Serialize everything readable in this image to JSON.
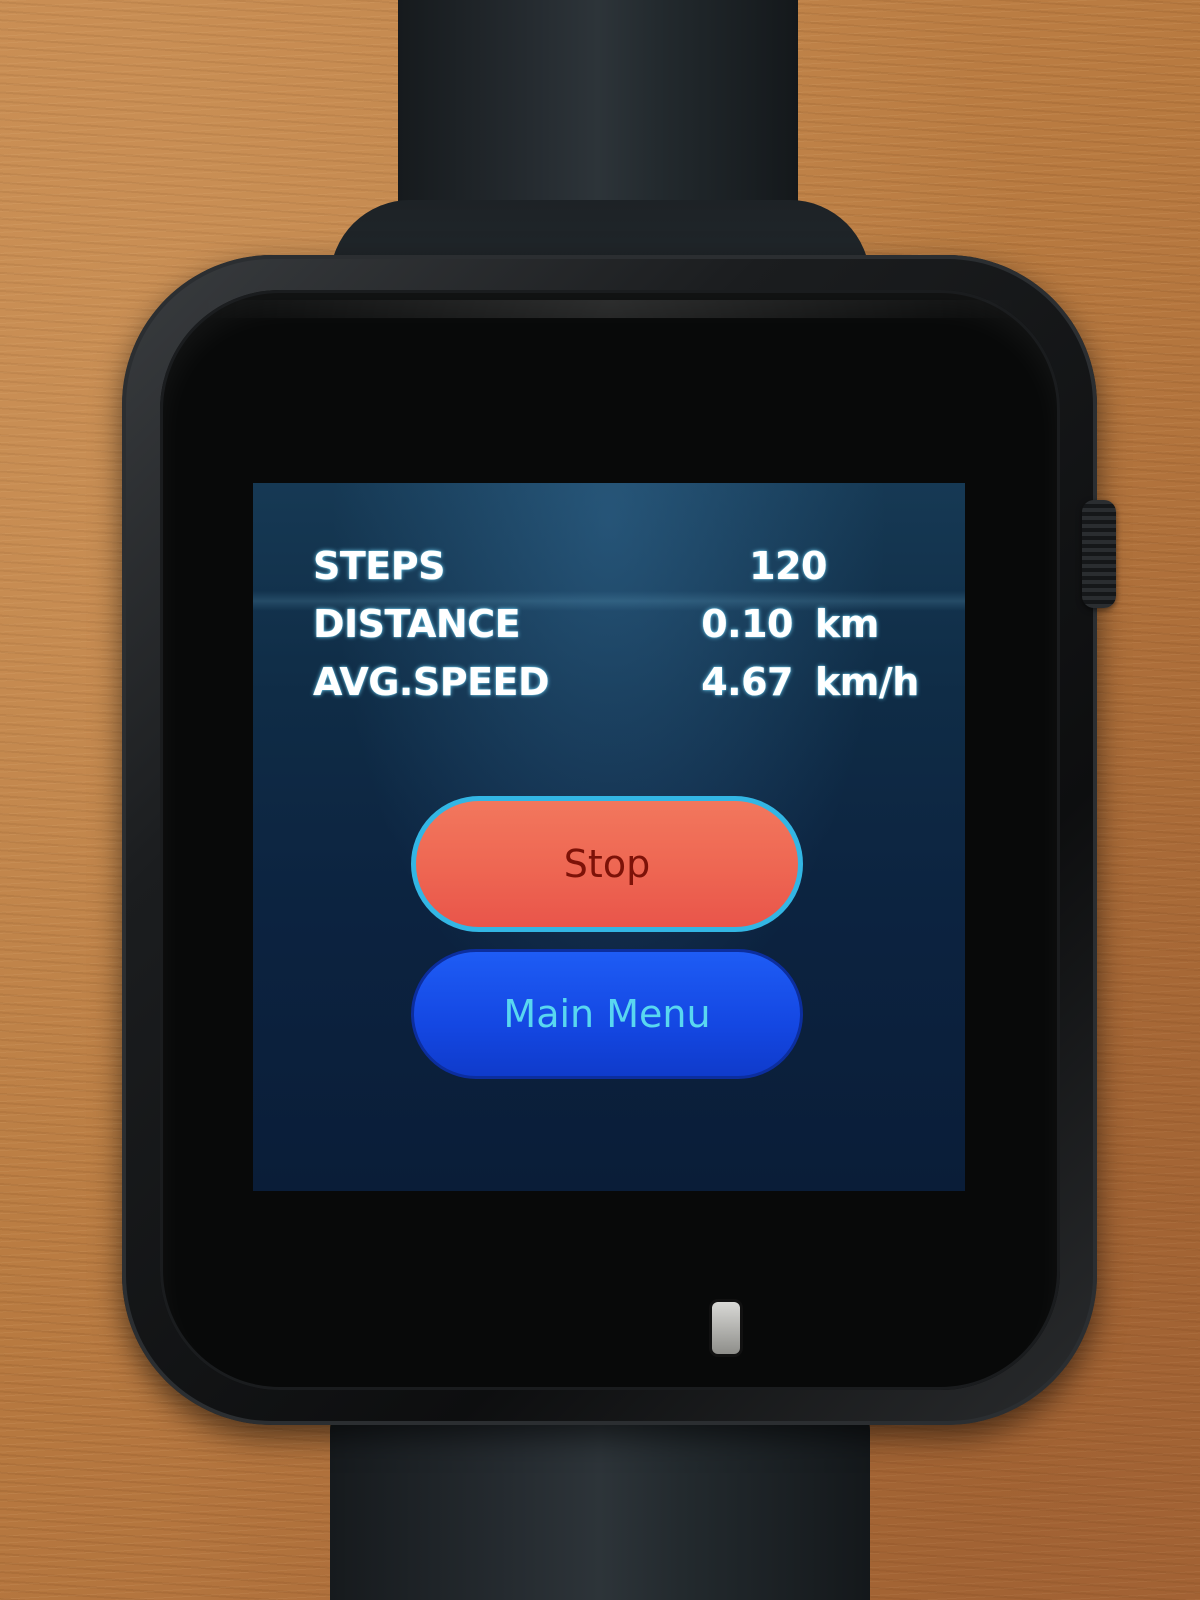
{
  "stats": {
    "steps": {
      "label": "STEPS",
      "value": "120",
      "unit": ""
    },
    "distance": {
      "label": "DISTANCE",
      "value": "0.10",
      "unit": "km"
    },
    "avg_speed": {
      "label": "AVG.SPEED",
      "value": "4.67",
      "unit": "km/h"
    }
  },
  "buttons": {
    "stop_label": "Stop",
    "main_menu_label": "Main Menu"
  },
  "colors": {
    "stop_button": "#ee6652",
    "stop_border": "#33b6e4",
    "main_menu_button": "#1447e2",
    "main_menu_text": "#59d7f0",
    "screen_background": "#0f2c46"
  }
}
